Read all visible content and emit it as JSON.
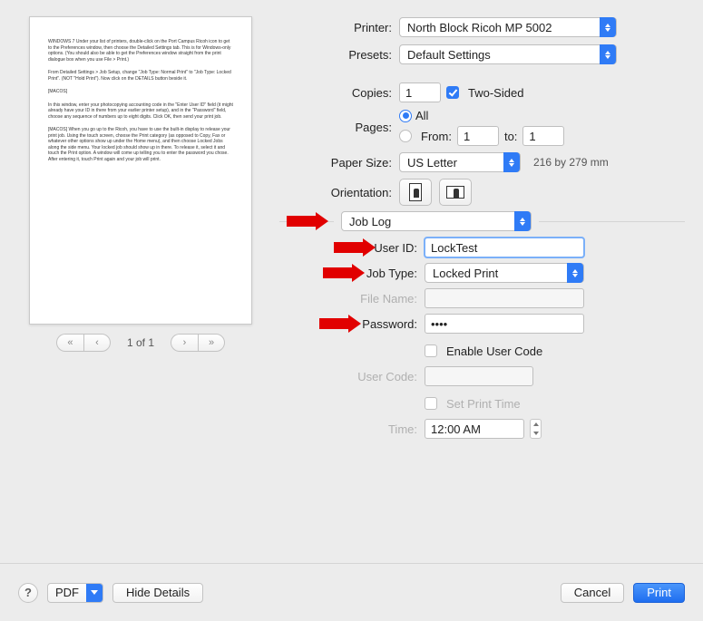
{
  "printer": {
    "label": "Printer:",
    "value": "North Block Ricoh MP 5002"
  },
  "presets": {
    "label": "Presets:",
    "value": "Default Settings"
  },
  "copies": {
    "label": "Copies:",
    "value": "1",
    "two_sided_label": "Two-Sided"
  },
  "pages": {
    "label": "Pages:",
    "all_label": "All",
    "from_label": "From:",
    "to_label": "to:",
    "from_value": "1",
    "to_value": "1"
  },
  "paper_size": {
    "label": "Paper Size:",
    "value": "US Letter",
    "note": "216 by 279 mm"
  },
  "orientation": {
    "label": "Orientation:"
  },
  "section": {
    "value": "Job Log"
  },
  "user_id": {
    "label": "User ID:",
    "value": "LockTest"
  },
  "job_type": {
    "label": "Job Type:",
    "value": "Locked Print"
  },
  "file_name": {
    "label": "File Name:",
    "value": ""
  },
  "password": {
    "label": "Password:",
    "value": "••••"
  },
  "enable_user_code": {
    "label": "Enable User Code"
  },
  "user_code": {
    "label": "User Code:",
    "value": ""
  },
  "set_print_time": {
    "label": "Set Print Time"
  },
  "time": {
    "label": "Time:",
    "value": "12:00 AM"
  },
  "preview": {
    "page_indicator": "1 of 1",
    "para1": "WINDOWS 7\nUnder your list of printers, double-click on the Port Campus Ricoh icon to get to the Preferences window, then choose the Detailed Settings tab. This is for Windows-only options. (You should also be able to get the Preferences window straight from the print dialogue box when you use File > Print.)",
    "para2": "From Detailed Settings > Job Setup, change \"Job Type: Normal Print\" to \"Job Type: Locked Print\". (NOT \"Hold Print\"). Now click on the DETAILS button beside it.",
    "para3": "[MACOS]",
    "para4": "In this window, enter your photocopying accounting code in the \"Enter User ID\" field (it might already have your ID in there from your earlier printer setup), and in the \"Password\" field, choose any sequence of numbers up to eight digits. Click OK, then send your print job.",
    "para5": "[MACOS]\nWhen you go up to the Ricoh, you have to use the built-in display to release your print job. Using the touch screen, choose the Print category (as opposed to Copy, Fax or whatever other options show up under the Home menu), and then choose Locked Jobs along the side menu. Your locked job should show up in there. To release it, select it and touch the Print option. A window will come up telling you to enter the password you chose. After entering it, touch Print again and your job will print."
  },
  "bottom": {
    "pdf": "PDF",
    "hide_details": "Hide Details",
    "cancel": "Cancel",
    "print": "Print"
  }
}
